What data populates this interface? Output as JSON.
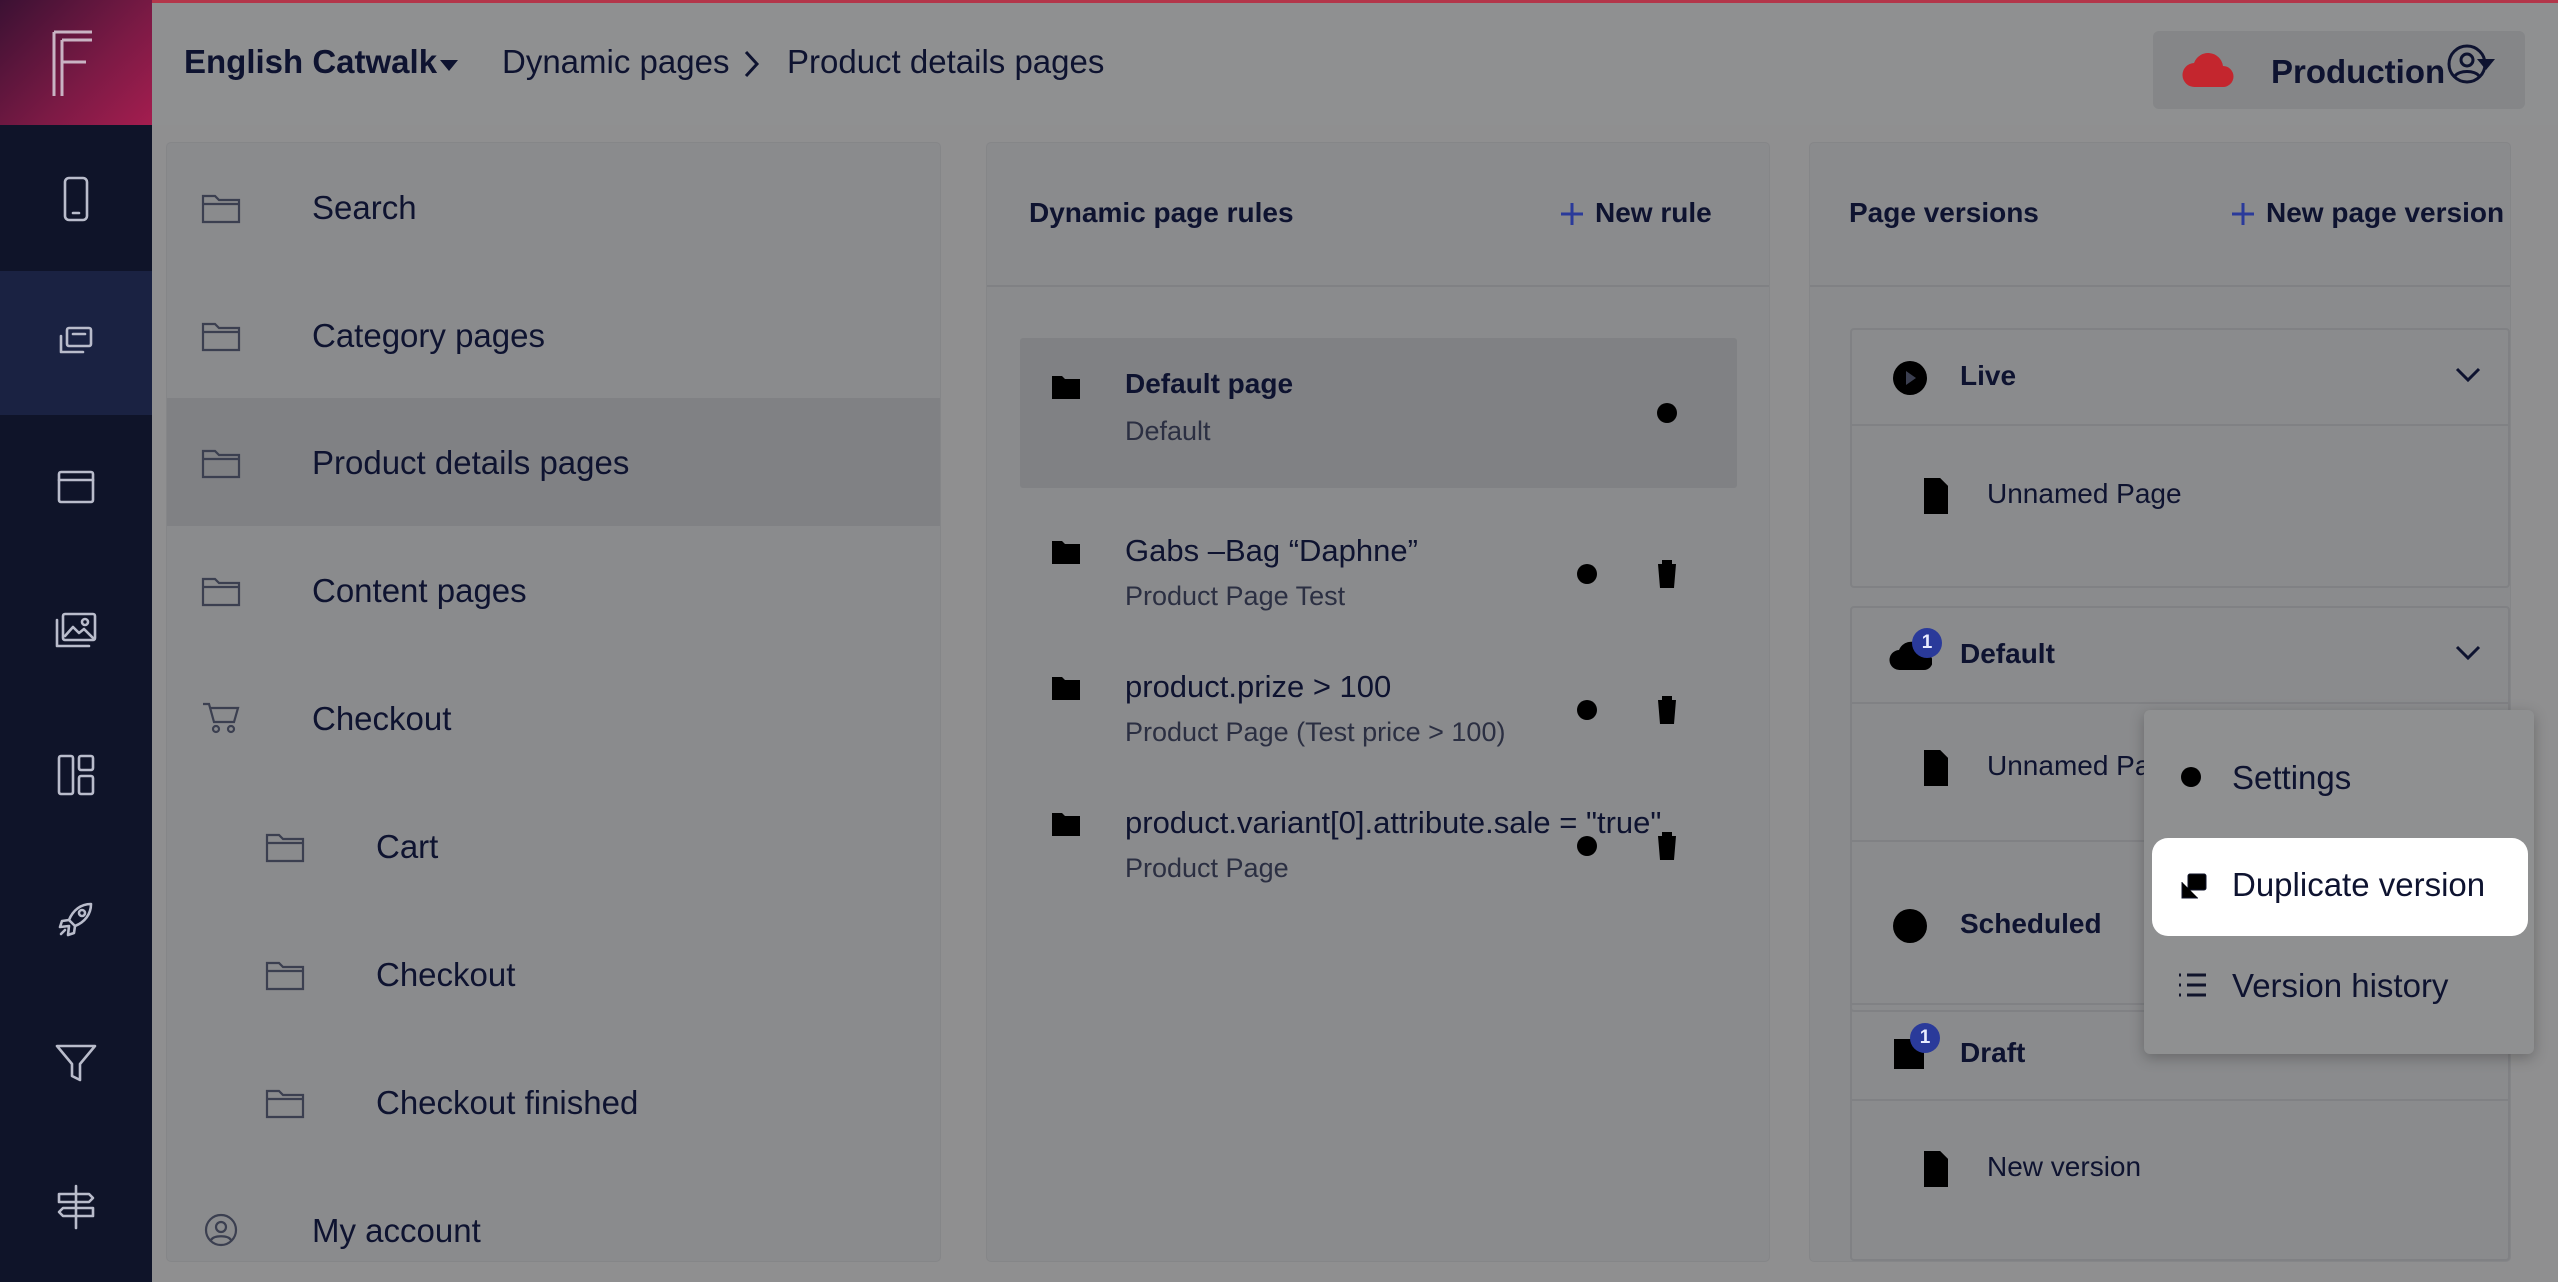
{
  "header": {
    "project": "English Catwalk",
    "breadcrumb": [
      "Dynamic pages",
      "Product details pages"
    ],
    "environment": "Production"
  },
  "sidebar_icons": [
    "phone-icon",
    "pages-icon",
    "window-icon",
    "media-icon",
    "layout-icon",
    "rocket-icon",
    "filter-icon",
    "signpost-icon"
  ],
  "tree": {
    "items": [
      {
        "label": "Search",
        "icon": "folder-icon"
      },
      {
        "label": "Category pages",
        "icon": "folder-icon"
      },
      {
        "label": "Product details pages",
        "icon": "folder-icon",
        "selected": true
      },
      {
        "label": "Content pages",
        "icon": "folder-icon"
      },
      {
        "label": "Checkout",
        "icon": "cart-icon"
      },
      {
        "label": "Cart",
        "icon": "folder-icon"
      },
      {
        "label": "Checkout",
        "icon": "folder-icon"
      },
      {
        "label": "Checkout finished",
        "icon": "folder-icon"
      },
      {
        "label": "My account",
        "icon": "user-icon"
      }
    ]
  },
  "rules": {
    "title": "Dynamic page rules",
    "new_label": "New rule",
    "items": [
      {
        "title": "Default page",
        "subtitle": "Default"
      },
      {
        "title": "Gabs –Bag “Daphne”",
        "subtitle": "Product Page Test"
      },
      {
        "title": "product.prize > 100",
        "subtitle": "Product Page (Test price > 100)"
      },
      {
        "title": "product.variant[0].attribute.sale = \"true\"",
        "subtitle": "Product Page"
      }
    ]
  },
  "versions": {
    "title": "Page versions",
    "new_label": "New page version",
    "groups": [
      {
        "label": "Live",
        "page": "Unnamed Page"
      },
      {
        "label": "Default",
        "badge": "1",
        "page": "Unnamed Pa"
      },
      {
        "label": "Scheduled"
      },
      {
        "label": "Draft",
        "badge": "1",
        "page": "New version"
      }
    ]
  },
  "menu": {
    "items": [
      "Settings",
      "Duplicate version",
      "Version history"
    ]
  },
  "colors": {
    "sidebar": "#0f1429",
    "overlay_bg": "#8f9091",
    "highlight": "#ffffff",
    "accent": "#2a3a9a",
    "cloud": "#c4262e"
  }
}
